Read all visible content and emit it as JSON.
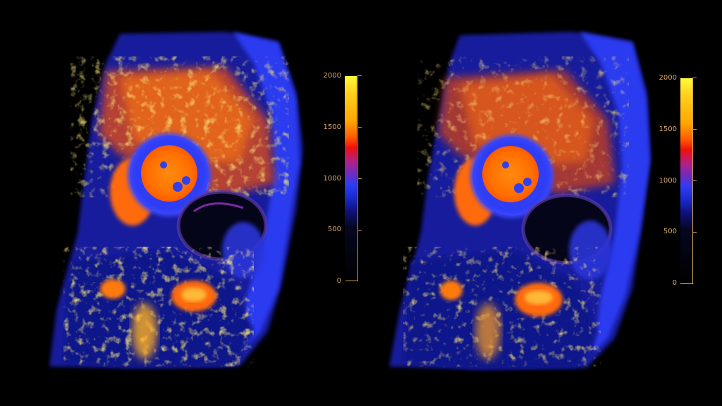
{
  "panels": [
    {
      "colorbar": {
        "ticks": [
          "2000",
          "1500",
          "1000",
          "500",
          "0"
        ],
        "colors": [
          "#fffb3a",
          "#ffa600",
          "#ee1010",
          "#6c2cc0",
          "#2f3cf2",
          "#000000"
        ]
      }
    },
    {
      "colorbar": {
        "ticks": [
          "2000",
          "1500",
          "1000",
          "500",
          "0"
        ],
        "colors": [
          "#fffb3a",
          "#ffa600",
          "#ee1010",
          "#6c2cc0",
          "#2f3cf2",
          "#000000"
        ]
      }
    }
  ],
  "background": "#000000"
}
